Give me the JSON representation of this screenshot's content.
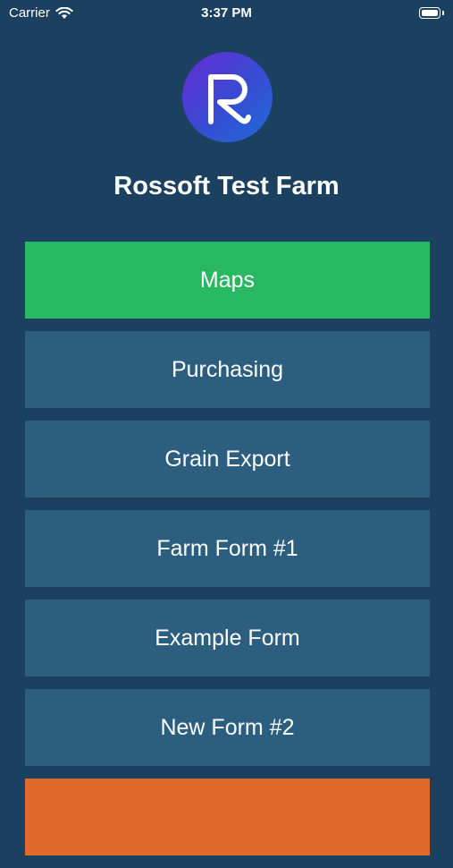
{
  "status_bar": {
    "carrier": "Carrier",
    "time": "3:37 PM",
    "wifi_icon": "wifi-icon",
    "battery_icon": "battery-icon"
  },
  "logo": {
    "icon": "r-logo-icon",
    "gradient": [
      "#6a2bd6",
      "#1e6bd8"
    ]
  },
  "title": "Rossoft Test Farm",
  "menu": {
    "items": [
      {
        "label": "Maps",
        "color": "#28b862"
      },
      {
        "label": "Purchasing",
        "color": "#2c5e80"
      },
      {
        "label": "Grain Export",
        "color": "#2c5e80"
      },
      {
        "label": "Farm Form #1",
        "color": "#2c5e80"
      },
      {
        "label": "Example Form",
        "color": "#2c5e80"
      },
      {
        "label": "New Form #2",
        "color": "#2c5e80"
      },
      {
        "label": "",
        "color": "#de6a2e"
      }
    ]
  },
  "colors": {
    "background": "#1b4060",
    "button": "#2c5e80",
    "accent_green": "#28b862",
    "accent_orange": "#de6a2e"
  }
}
